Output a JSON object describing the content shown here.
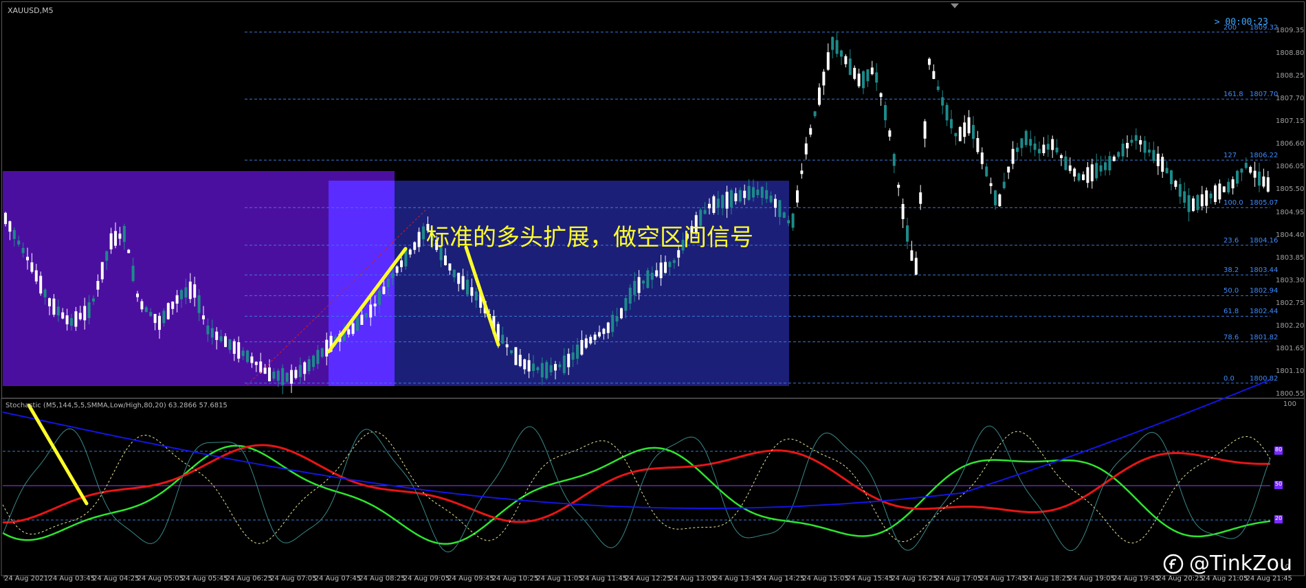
{
  "window": {
    "symbol": "XAUUSD,M5",
    "timer": "> 00:00:23"
  },
  "fib_levels": [
    {
      "ratio": "200",
      "price": "1809.32"
    },
    {
      "ratio": "161.8",
      "price": "1807.70"
    },
    {
      "ratio": "127",
      "price": "1806.22"
    },
    {
      "ratio": "100.0",
      "price": "1805.07"
    },
    {
      "ratio": "23.6",
      "price": "1804.16"
    },
    {
      "ratio": "38.2",
      "price": "1803.44"
    },
    {
      "ratio": "50.0",
      "price": "1802.94"
    },
    {
      "ratio": "61.8",
      "price": "1802.44"
    },
    {
      "ratio": "78.6",
      "price": "1801.82"
    },
    {
      "ratio": "0.0",
      "price": "1800.82"
    }
  ],
  "price_axis": [
    "1809.35",
    "1808.80",
    "1808.25",
    "1807.70",
    "1807.15",
    "1806.60",
    "1806.05",
    "1805.50",
    "1804.95",
    "1804.40",
    "1803.85",
    "1803.30",
    "1802.75",
    "1802.20",
    "1801.65",
    "1801.10",
    "1800.55"
  ],
  "annotation": "标准的多头扩展，做空区间信号",
  "stochastic": {
    "title": "Stochastic (M5,144,5,5,SMMA,Low/High,80,20) 63.2866 57.6815",
    "axis_top": "100",
    "axis_bottom": "0",
    "levels": [
      "80",
      "50",
      "20"
    ]
  },
  "time_axis": [
    "24 Aug 2021",
    "24 Aug 03:45",
    "24 Aug 04:25",
    "24 Aug 05:05",
    "24 Aug 05:45",
    "24 Aug 06:25",
    "24 Aug 07:05",
    "24 Aug 07:45",
    "24 Aug 08:25",
    "24 Aug 09:05",
    "24 Aug 09:45",
    "24 Aug 10:25",
    "24 Aug 11:05",
    "24 Aug 11:45",
    "24 Aug 12:25",
    "24 Aug 13:05",
    "24 Aug 13:45",
    "24 Aug 14:25",
    "24 Aug 15:05",
    "24 Aug 15:45",
    "24 Aug 16:25",
    "24 Aug 17:05",
    "24 Aug 17:45",
    "24 Aug 18:25",
    "24 Aug 19:05",
    "24 Aug 19:45",
    "24 Aug 20:25",
    "24 Aug 21:05",
    "24 Aug 21:45"
  ],
  "watermark": "@TinkZou",
  "colors": {
    "bull_candle": "#1e8a8a",
    "bear_candle": "#ffffff",
    "fib_line": "#3a7bd5",
    "zone_left": "#4b0fa0",
    "zone_mid": "#5a2cff",
    "zone_right": "#1c1f78",
    "annotation": "#ffff2a"
  }
}
